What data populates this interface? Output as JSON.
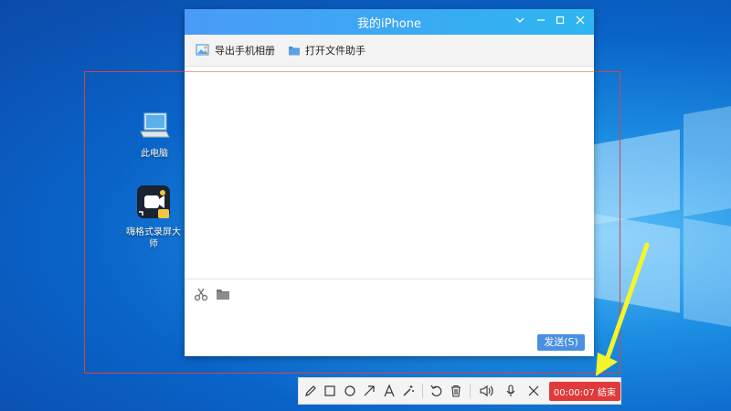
{
  "desktop": {
    "icons": [
      {
        "label": "此电脑",
        "icon": "computer-icon"
      },
      {
        "label": "嗨格式录屏大师",
        "icon": "screen-recorder-app-icon"
      }
    ]
  },
  "window": {
    "title": "我的iPhone",
    "controls": [
      "chevron-down-icon",
      "minimize-icon",
      "maximize-icon",
      "close-icon"
    ],
    "toolbar": {
      "export_album": "导出手机相册",
      "open_assistant": "打开文件助手"
    },
    "compose": {
      "tools": [
        "scissors-icon",
        "folder-icon"
      ],
      "send_label": "发送(S)"
    }
  },
  "recorder": {
    "tools": [
      "pencil-icon",
      "rectangle-icon",
      "circle-icon",
      "arrow-icon",
      "text-icon",
      "magic-wand-icon",
      "undo-icon",
      "trash-icon",
      "speaker-icon",
      "microphone-icon",
      "close-icon"
    ],
    "timer": "00:00:07",
    "stop_label": "结束",
    "accent": "#e03a3a"
  },
  "colors": {
    "titlebar_start": "#4a9bf6",
    "titlebar_end": "#2eb6f0",
    "send_button": "#4a90e2",
    "annotation_arrow": "#f5f52a",
    "frame_border": "#d4463f"
  }
}
